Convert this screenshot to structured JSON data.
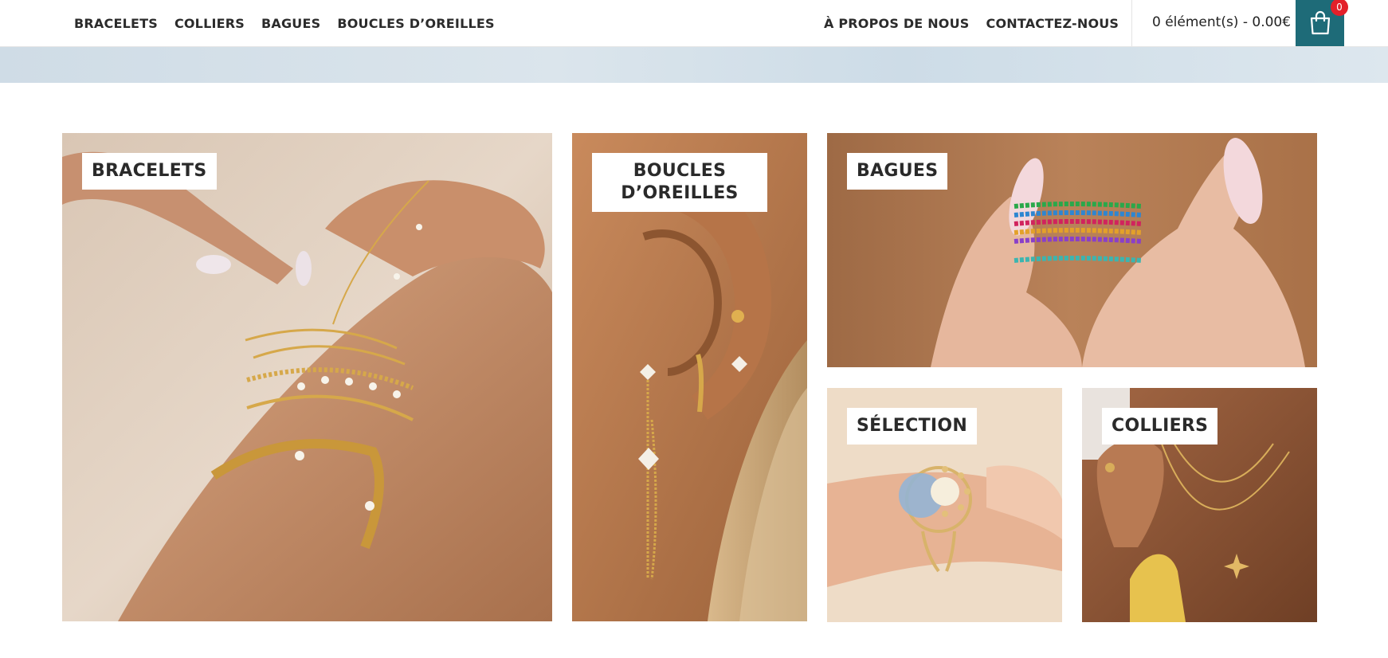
{
  "nav": {
    "left": [
      "BRACELETS",
      "COLLIERS",
      "BAGUES",
      "BOUCLES D’OREILLES"
    ],
    "right": [
      "À PROPOS DE NOUS",
      "CONTACTEZ-NOUS"
    ]
  },
  "cart": {
    "summary": "0 élément(s) - 0.00€",
    "badge": "0",
    "icon": "shopping-bag-icon"
  },
  "tiles": {
    "bracelets": "BRACELETS",
    "earrings_line1": "BOUCLES",
    "earrings_line2": "D’OREILLES",
    "rings": "BAGUES",
    "selection": "SÉLECTION",
    "necklaces": "COLLIERS"
  },
  "colors": {
    "accent": "#1e6b78",
    "badge": "#e3202a",
    "nav_text": "#2b2b2b",
    "hero_strip": "#d5e1ea"
  }
}
